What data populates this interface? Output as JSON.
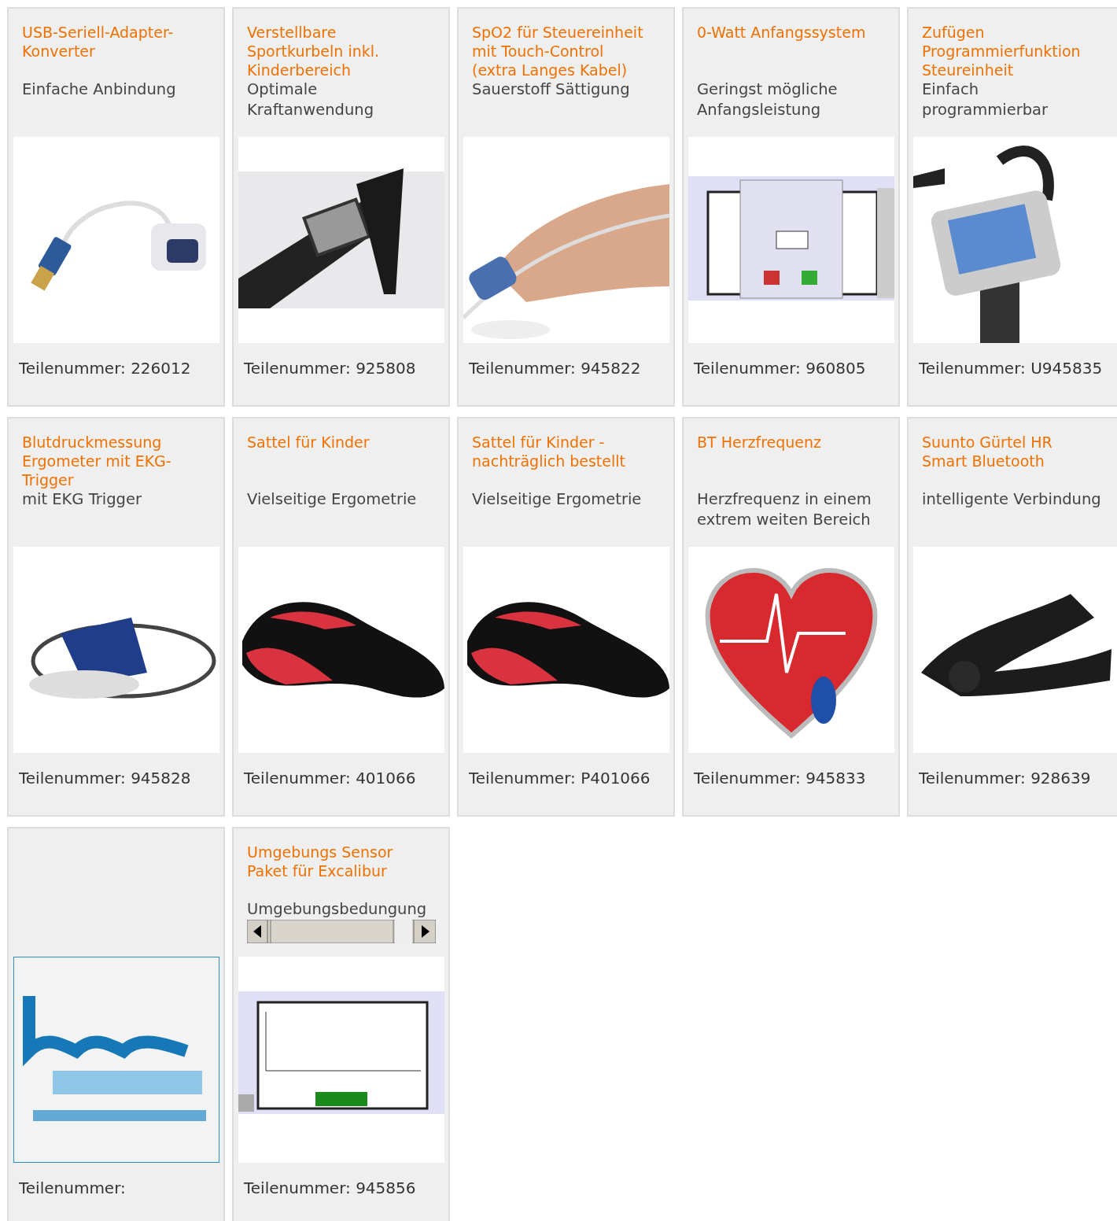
{
  "products": [
    {
      "kind": "plain",
      "title": "USB-Seriell-Adapter-Konverter",
      "description": "Einfache Anbindung",
      "part_number": "Teilenummer: 226012"
    },
    {
      "kind": "plain",
      "title": "Verstellbare Sportkurbeln inkl. Kinderbereich",
      "description": "Optimale Kraftanwendung",
      "part_number": "Teilenummer: 925808"
    },
    {
      "kind": "plain",
      "title": "SpO2 für Steuereinheit mit Touch-Control (extra Langes Kabel)",
      "description": "Sauerstoff Sättigung",
      "part_number": "Teilenummer: 945822"
    },
    {
      "kind": "plain",
      "title": "0-Watt Anfangssystem",
      "description": "Geringst mögliche Anfangsleistung",
      "part_number": "Teilenummer: 960805"
    },
    {
      "kind": "plain",
      "title": "Zufügen Programmierfunktion Steureinheit",
      "description": "Einfach programmierbar",
      "part_number": "Teilenummer: U945835"
    },
    {
      "kind": "plain",
      "title": "Blutdruckmessung Ergometer mit EKG-Trigger",
      "description": "mit EKG Trigger",
      "part_number": "Teilenummer: 945828"
    },
    {
      "kind": "plain",
      "title": "Sattel für Kinder",
      "description": "Vielseitige Ergometrie",
      "part_number": "Teilenummer: 401066"
    },
    {
      "kind": "plain",
      "title": "Sattel für Kinder - nachträglich bestellt",
      "description": "Vielseitige Ergometrie",
      "part_number": "Teilenummer: P401066"
    },
    {
      "kind": "plain",
      "title": "BT Herzfrequenz",
      "description": "Herzfrequenz in einem extrem weiten Bereich",
      "part_number": "Teilenummer: 945833"
    },
    {
      "kind": "plain",
      "title": "Suunto Gürtel HR Smart Bluetooth",
      "description": "intelligente Verbindung",
      "part_number": "Teilenummer: 928639"
    },
    {
      "kind": "plain",
      "part_number": "Teilenummer:"
    },
    {
      "kind": "scrolling",
      "title": "Umgebungs Sensor Paket für Excalibur",
      "description": "Umgebungsbedungung",
      "part_number": "Teilenummer: 945856"
    }
  ]
}
